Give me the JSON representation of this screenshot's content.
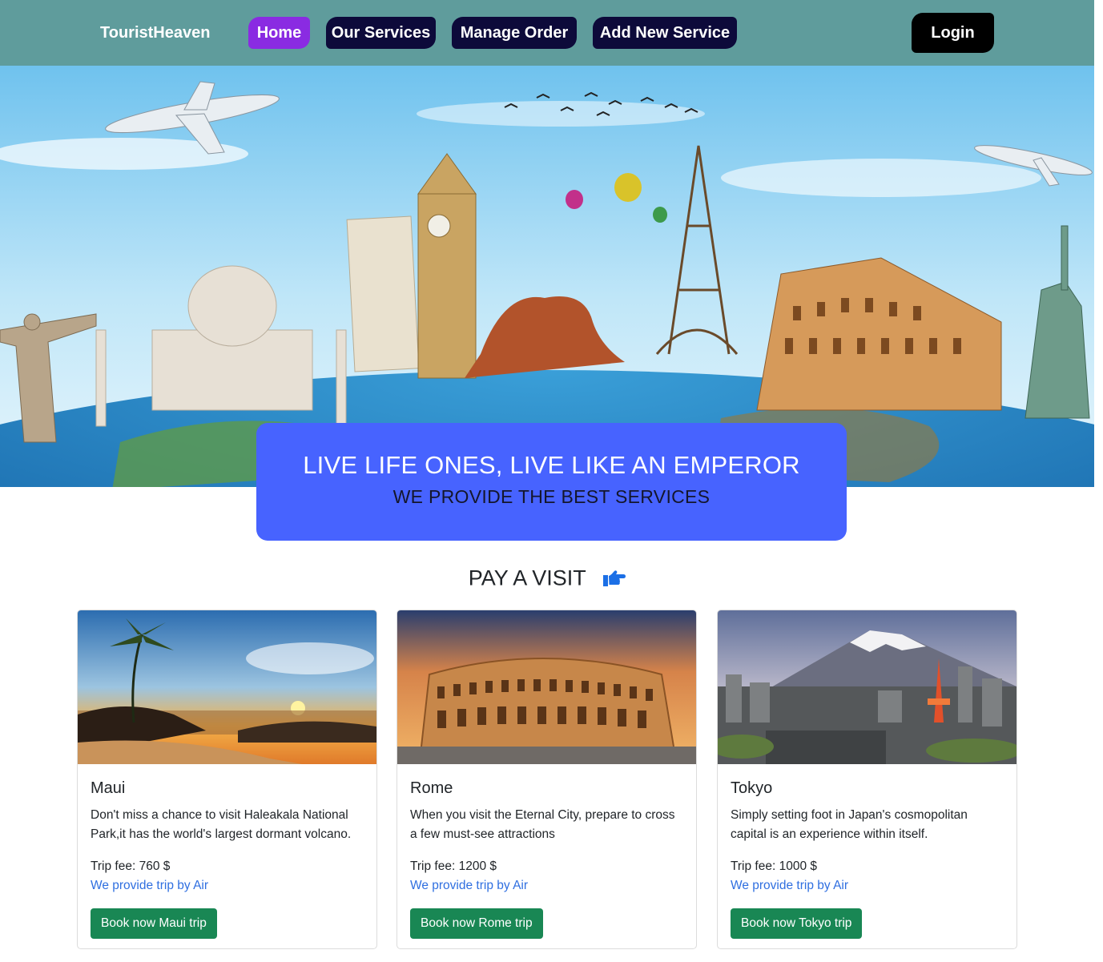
{
  "nav": {
    "brand": "TouristHeaven",
    "items": [
      {
        "label": "Home",
        "active": true
      },
      {
        "label": "Our Services",
        "active": false
      },
      {
        "label": "Manage Order",
        "active": false
      },
      {
        "label": "Add New Service",
        "active": false
      }
    ],
    "login_label": "Login"
  },
  "banner": {
    "title": "LIVE LIFE ONES, LIVE LIKE AN EMPEROR",
    "subtitle": "WE PROVIDE THE BEST SERVICES"
  },
  "section": {
    "title": "PAY A VISIT",
    "icon": "hand-point-right-icon"
  },
  "cards": [
    {
      "title": "Maui",
      "text": "Don't miss a chance to visit Haleakala National Park,it has the world's largest dormant volcano.",
      "fee": "Trip fee: 760 $",
      "link": "We provide trip by Air",
      "button": "Book now Maui trip"
    },
    {
      "title": "Rome",
      "text": "When you visit the Eternal City, prepare to cross a few must-see attractions",
      "fee": "Trip fee: 1200 $",
      "link": "We provide trip by Air",
      "button": "Book now Rome trip"
    },
    {
      "title": "Tokyo",
      "text": "Simply setting foot in Japan's cosmopolitan capital is an experience within itself.",
      "fee": "Trip fee: 1000 $",
      "link": "We provide trip by Air",
      "button": "Book now Tokyo trip"
    }
  ],
  "colors": {
    "navbar": "#5f9c9c",
    "active_nav": "#8a2be2",
    "nav_button": "#0d0a3a",
    "banner": "#4763ff",
    "book_button": "#198754",
    "link": "#2f6fe0"
  }
}
